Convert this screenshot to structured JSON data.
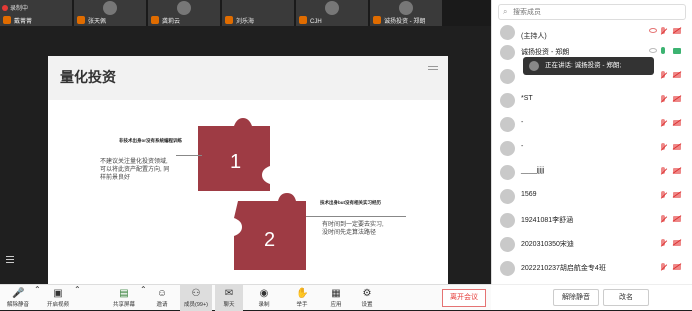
{
  "recording": {
    "label": "录制中"
  },
  "thumbnails": [
    {
      "name": "戴菁菁"
    },
    {
      "name": "张天佩"
    },
    {
      "name": "龚莉云"
    },
    {
      "name": "刘乐海"
    },
    {
      "name": "CJH"
    },
    {
      "name": "诚扬投资 - 郑朗"
    }
  ],
  "slide": {
    "title": "量化投资",
    "piece1_number": "1",
    "piece2_number": "2",
    "point1_title": "非技术出身or没有系统编程训练",
    "point1_body": [
      "不建议关注量化投资领域,",
      "可以将此资产配置方向, 同",
      "样前景良好"
    ],
    "point2_title": "技术出身but没有相关实习经历",
    "point2_body": [
      "有时间到一定要去实习,",
      "没时间先走算法路径"
    ]
  },
  "toolbar": {
    "mute": "解除静音",
    "video": "开启视频",
    "share": "共享屏幕",
    "invite": "邀请",
    "members": "成员(99+)",
    "chat": "聊天",
    "record": "录制",
    "raise_hand": "举手",
    "apps": "应用",
    "settings": "设置",
    "leave": "离开会议"
  },
  "panel": {
    "search_placeholder": "搜索成员",
    "members": [
      {
        "name": "(主持人)",
        "sub": ""
      },
      {
        "name": "诚扬投资 - 郑朗",
        "sub": ""
      },
      {
        "name": "",
        "sub": ""
      },
      {
        "name": "*ST",
        "sub": ""
      },
      {
        "name": "-",
        "sub": ""
      },
      {
        "name": "-",
        "sub": ""
      },
      {
        "name": "____jjjjj",
        "sub": ""
      },
      {
        "name": "1569",
        "sub": ""
      },
      {
        "name": "19241081李舒涵",
        "sub": ""
      },
      {
        "name": "2020310350宋迪",
        "sub": ""
      },
      {
        "name": "2022210237胡启航金专4班",
        "sub": ""
      },
      {
        "name": "",
        "sub": ""
      }
    ],
    "speaking_tooltip": "正在讲话: 诚扬投资 - 郑朗;",
    "unmute_all": "解除静音",
    "rename": "改名"
  },
  "colors": {
    "puzzle": "#9e3b44",
    "leave": "#e53935",
    "mic_on": "#3cb371"
  }
}
